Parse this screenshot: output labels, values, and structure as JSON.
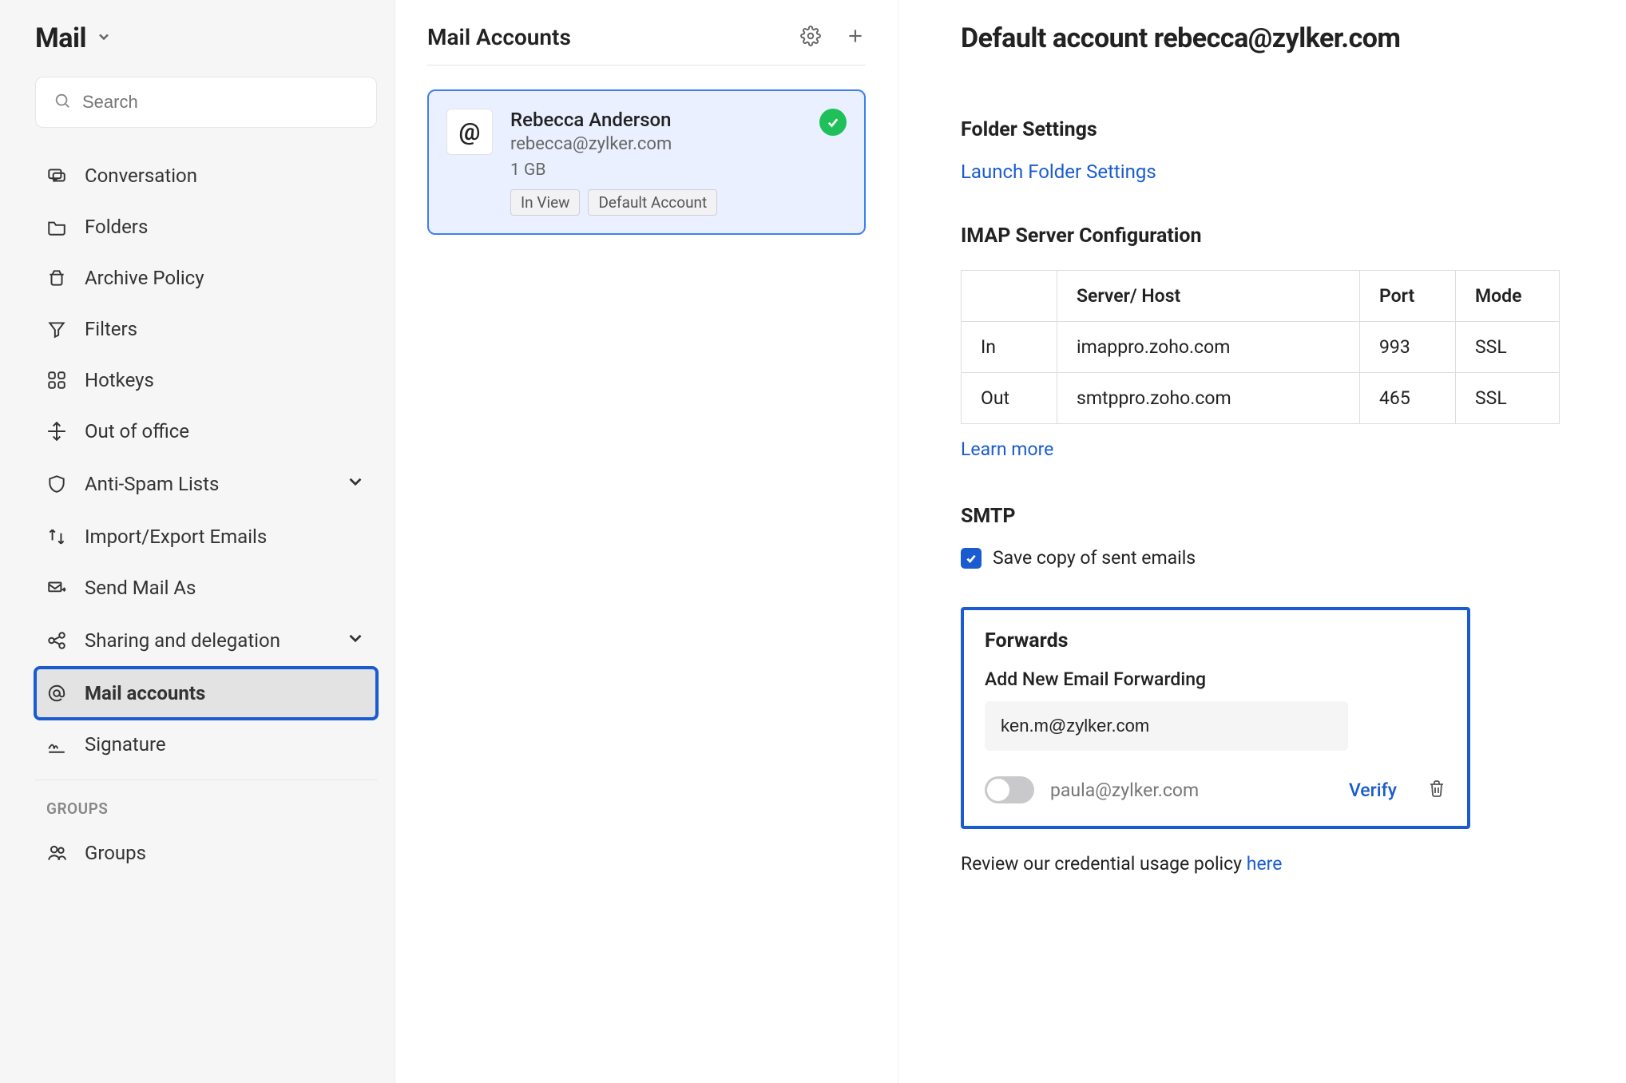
{
  "sidebar": {
    "title": "Mail",
    "search_placeholder": "Search",
    "items": [
      {
        "label": "Conversation"
      },
      {
        "label": "Folders"
      },
      {
        "label": "Archive Policy"
      },
      {
        "label": "Filters"
      },
      {
        "label": "Hotkeys"
      },
      {
        "label": "Out of office"
      },
      {
        "label": "Anti-Spam Lists",
        "expandable": true
      },
      {
        "label": "Import/Export Emails"
      },
      {
        "label": "Send Mail As"
      },
      {
        "label": "Sharing and delegation",
        "expandable": true
      },
      {
        "label": "Mail accounts",
        "active": true
      },
      {
        "label": "Signature"
      }
    ],
    "group_label": "GROUPS",
    "group_items": [
      {
        "label": "Groups"
      }
    ]
  },
  "mid": {
    "title": "Mail Accounts",
    "account": {
      "name": "Rebecca Anderson",
      "email": "rebecca@zylker.com",
      "size": "1 GB",
      "badge_inview": "In View",
      "badge_default": "Default Account"
    }
  },
  "right": {
    "title": "Default account rebecca@zylker.com",
    "folder_heading": "Folder Settings",
    "folder_link": "Launch Folder Settings",
    "imap_heading": "IMAP Server Configuration",
    "imap_headers": {
      "server": "Server/ Host",
      "port": "Port",
      "mode": "Mode"
    },
    "imap_rows": [
      {
        "dir": "In",
        "host": "imappro.zoho.com",
        "port": "993",
        "mode": "SSL"
      },
      {
        "dir": "Out",
        "host": "smtppro.zoho.com",
        "port": "465",
        "mode": "SSL"
      }
    ],
    "learn_more": "Learn more",
    "smtp_heading": "SMTP",
    "smtp_checkbox_label": "Save copy of sent emails",
    "forwards_heading": "Forwards",
    "forwards_sub": "Add New Email Forwarding",
    "forwards_input_value": "ken.m@zylker.com",
    "pending_forward": "paula@zylker.com",
    "verify_label": "Verify",
    "policy_text": "Review our credential usage policy ",
    "policy_link": "here"
  }
}
